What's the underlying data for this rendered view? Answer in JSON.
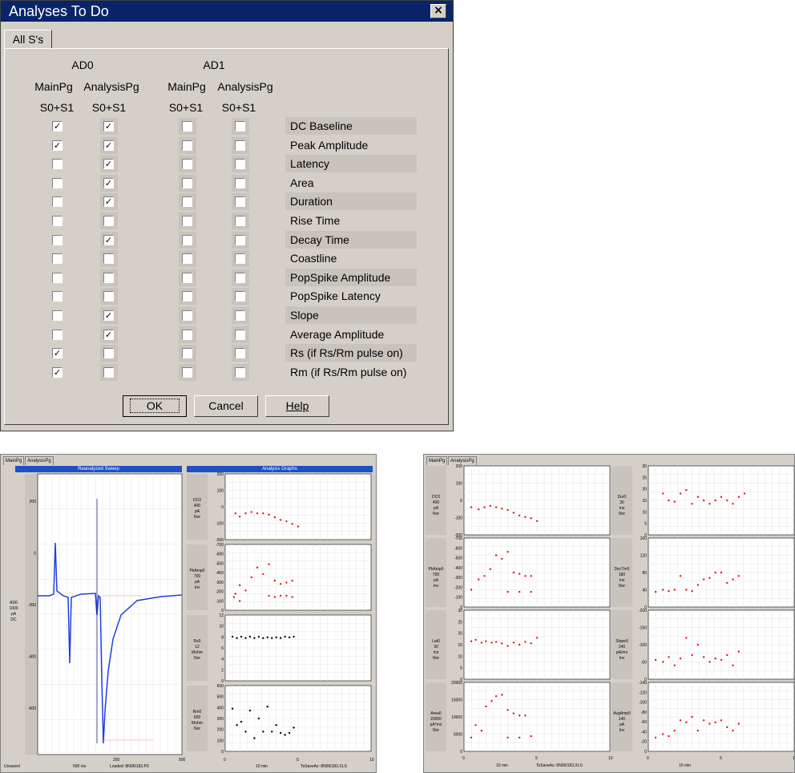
{
  "dialog": {
    "title": "Analyses To Do",
    "close_label": "×",
    "tab_label": "All S's",
    "ad0_label": "AD0",
    "ad1_label": "AD1",
    "col_headers": [
      "MainPg",
      "AnalysisPg",
      "MainPg",
      "AnalysisPg"
    ],
    "col_sub": [
      "S0+S1",
      "S0+S1",
      "S0+S1",
      "S0+S1"
    ],
    "check_mark": "✓",
    "rows": [
      {
        "label": "DC Baseline",
        "checks": [
          true,
          true,
          false,
          false
        ]
      },
      {
        "label": "Peak Amplitude",
        "checks": [
          true,
          true,
          false,
          false
        ]
      },
      {
        "label": "Latency",
        "checks": [
          false,
          true,
          false,
          false
        ]
      },
      {
        "label": "Area",
        "checks": [
          false,
          true,
          false,
          false
        ]
      },
      {
        "label": "Duration",
        "checks": [
          false,
          true,
          false,
          false
        ]
      },
      {
        "label": "Rise Time",
        "checks": [
          false,
          false,
          false,
          false
        ]
      },
      {
        "label": "Decay Time",
        "checks": [
          false,
          true,
          false,
          false
        ]
      },
      {
        "label": "Coastline",
        "checks": [
          false,
          false,
          false,
          false
        ]
      },
      {
        "label": "PopSpike Amplitude",
        "checks": [
          false,
          false,
          false,
          false
        ]
      },
      {
        "label": "PopSpike Latency",
        "checks": [
          false,
          false,
          false,
          false
        ]
      },
      {
        "label": "Slope",
        "checks": [
          false,
          true,
          false,
          false
        ]
      },
      {
        "label": "Average Amplitude",
        "checks": [
          false,
          true,
          false,
          false
        ]
      },
      {
        "label": "Rs (if Rs/Rm pulse on)",
        "checks": [
          true,
          false,
          false,
          false
        ]
      },
      {
        "label": "Rm (if Rs/Rm pulse on)",
        "checks": [
          true,
          false,
          false,
          false
        ]
      }
    ],
    "buttons": {
      "ok": "OK",
      "cancel": "Cancel",
      "help": "Help"
    }
  },
  "main_window": {
    "tabs": [
      "MainPg",
      "AnalysisPg"
    ],
    "sweep_title": "Reanalyzed Sweep",
    "graphs_title": "Analysis Graphs",
    "sweep_yticks": [
      "200",
      "0",
      "-200",
      "-400",
      "-600"
    ],
    "sweep_xticks": [
      "250",
      "500"
    ],
    "sweep_side": [
      "AD0",
      "1000",
      "pA",
      "DC"
    ],
    "sweep_footer": {
      "left": "Unsaved",
      "scale": "500 ms",
      "loaded": "Loaded: 8N06I183.P0"
    },
    "graphs": [
      {
        "side": [
          "DC0",
          "400",
          "pA",
          "Nor"
        ],
        "yticks": [
          "200",
          "100",
          "0",
          "-100",
          "-200"
        ]
      },
      {
        "side": [
          "PkAmp0",
          "700",
          "pA",
          "Inv"
        ],
        "yticks": [
          "-700",
          "-600",
          "-500",
          "-400",
          "-300",
          "-200",
          "-100",
          "0"
        ]
      },
      {
        "side": [
          "Rs0",
          "12",
          "Mohm",
          "Nor"
        ],
        "yticks": [
          "12",
          "10",
          "8",
          "6",
          "4",
          "2",
          "0"
        ]
      },
      {
        "side": [
          "Rm0",
          "600",
          "Mohm",
          "Nor"
        ],
        "yticks": [
          "600",
          "500",
          "400",
          "300",
          "200",
          "100",
          "0"
        ]
      }
    ],
    "xticks": [
      "0",
      "5",
      "10"
    ],
    "graph_footer": {
      "scale": "10 min",
      "save": "ToSaveAs: 8N06I183.XLS"
    }
  },
  "analysis_window": {
    "tabs": [
      "MainPg",
      "AnalysisPg"
    ],
    "left_graphs": [
      {
        "side": [
          "DC0",
          "400",
          "pA",
          "Nor"
        ],
        "yticks": [
          "200",
          "100",
          "0",
          "-100",
          "-200"
        ]
      },
      {
        "side": [
          "PkAmp0",
          "700",
          "pA",
          "Inv"
        ],
        "yticks": [
          "-700",
          "-600",
          "-500",
          "-400",
          "-300",
          "-200",
          "-100",
          "0"
        ]
      },
      {
        "side": [
          "Lat0",
          "30",
          "ms",
          "Nor"
        ],
        "yticks": [
          "30",
          "25",
          "20",
          "15",
          "10",
          "5",
          "0"
        ]
      },
      {
        "side": [
          "Area0",
          "20000",
          "pA*ms",
          "Nor"
        ],
        "yticks": [
          "20000",
          "15000",
          "10000",
          "5000",
          "0"
        ]
      }
    ],
    "right_graphs": [
      {
        "side": [
          "Dur0",
          "30",
          "ms",
          "Nor"
        ],
        "yticks": [
          "30",
          "25",
          "20",
          "15",
          "10",
          "5",
          "0"
        ]
      },
      {
        "side": [
          "DecTm0",
          "180",
          "ms",
          "Nor"
        ],
        "yticks": [
          "160",
          "120",
          "80",
          "40",
          "0"
        ]
      },
      {
        "side": [
          "Slope0",
          "240",
          "pA/ms",
          "Inv"
        ],
        "yticks": [
          "-200",
          "-150",
          "-100",
          "-50",
          "0"
        ]
      },
      {
        "side": [
          "AvgAmp0",
          "140",
          "pA",
          "Inv"
        ],
        "yticks": [
          "-140",
          "-120",
          "-100",
          "-80",
          "-60",
          "-40",
          "-20",
          "0"
        ]
      }
    ],
    "xticks": [
      "0",
      "5",
      "10"
    ],
    "footer": {
      "left_scale": "10 min",
      "save": "ToSaveAs: 8N06I183.XLS",
      "right_scale": "10 min"
    }
  },
  "colors": {
    "titlebar": "#0a246a",
    "dialog_bg": "#d4d0c8",
    "trace": "#1f3fe0",
    "points_red": "#e0141e",
    "points_blue": "#3030c0",
    "points_black": "#000000"
  }
}
